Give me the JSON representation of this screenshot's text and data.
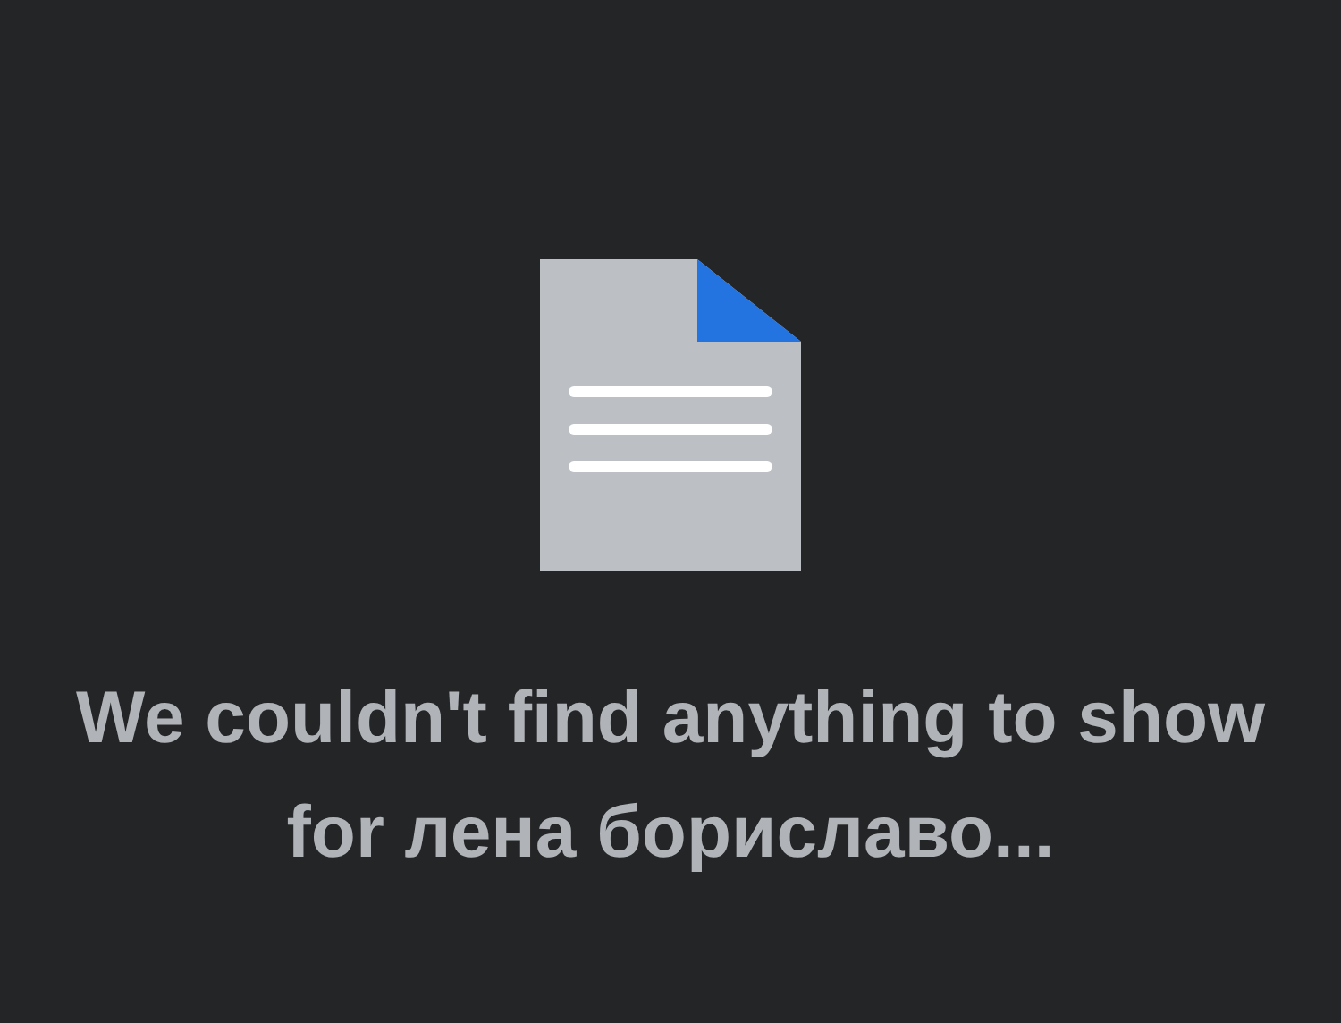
{
  "empty_state": {
    "message": "We couldn't find anything to show for лена бориславо..."
  }
}
